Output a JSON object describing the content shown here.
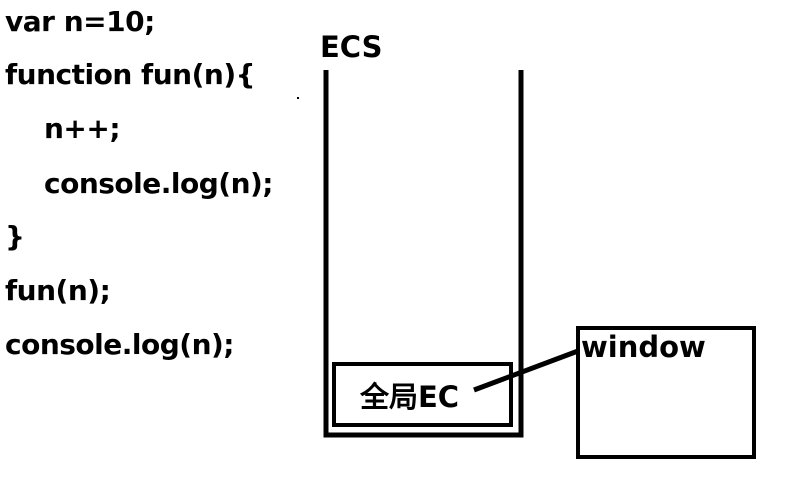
{
  "code": {
    "lines": [
      "var n=10;",
      "function fun(n){",
      "n++;",
      "console.log(n);",
      "}",
      "fun(n);",
      "console.log(n);"
    ]
  },
  "diagram": {
    "stack_label": "ECS",
    "global_ec_label": "全局EC",
    "window_label": "window"
  }
}
